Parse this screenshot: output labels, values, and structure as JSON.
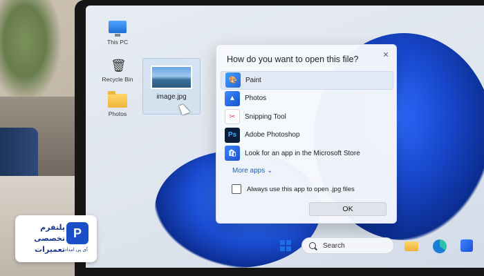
{
  "desktop": {
    "icons": [
      {
        "label": "This PC",
        "icon": "computer-icon"
      },
      {
        "label": "Recycle Bin",
        "icon": "recycle-bin-icon"
      },
      {
        "label": "Photos",
        "icon": "folder-icon"
      }
    ],
    "selected_file": {
      "name": "image.jpg",
      "icon": "image-thumbnail"
    }
  },
  "dialog": {
    "title": "How do you want to open this file?",
    "apps": [
      {
        "label": "Paint",
        "icon": "paint-icon",
        "selected": true
      },
      {
        "label": "Photos",
        "icon": "photos-icon",
        "selected": false
      },
      {
        "label": "Snipping Tool",
        "icon": "snipping-tool-icon",
        "selected": false
      },
      {
        "label": "Adobe Photoshop",
        "icon": "photoshop-icon",
        "icon_text": "Ps",
        "selected": false
      },
      {
        "label": "Look for an app in the Microsoft Store",
        "icon": "store-icon",
        "selected": false
      }
    ],
    "more_apps_label": "More apps",
    "always_use_label": "Always use this app to open .jpg files",
    "always_use_checked": false,
    "ok_label": "OK"
  },
  "taskbar": {
    "search_label": "Search",
    "items": [
      "start-icon",
      "search-box",
      "file-explorer-icon",
      "edge-icon",
      "store-icon"
    ]
  },
  "brand": {
    "line1": "پلتفرم",
    "line2": "تخصصی",
    "line3": "تعمیرات",
    "subtitle": "آی پی امداد",
    "logo_glyph": "P",
    "colors": {
      "primary": "#1b4fc7"
    }
  },
  "colors": {
    "accent": "#1f5fbf",
    "selected_row": "#e1e9f7"
  }
}
